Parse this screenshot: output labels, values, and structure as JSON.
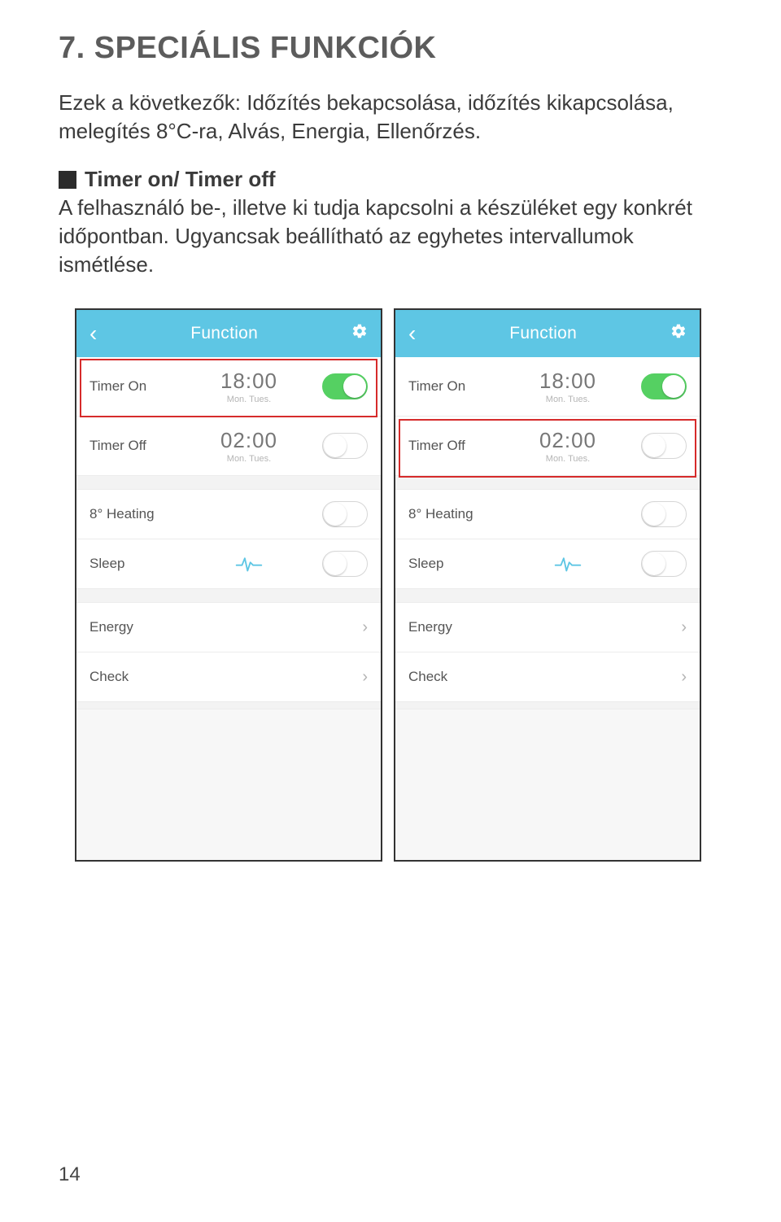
{
  "page": {
    "title": "7. SPECIÁLIS FUNKCIÓK",
    "paragraph": "Ezek a következők: Időzítés bekapcsolása, időzítés kikapcsolása, melegítés 8°C-ra, Alvás, Energia, Ellenőrzés.",
    "sub_heading": "Timer on/ Timer off",
    "sub_body": "A felhasználó be-, illetve ki tudja kapcsolni a készüléket egy konkrét időpontban. Ugyancsak beállítható az egyhetes intervallumok ismétlése.",
    "page_number": "14"
  },
  "app": {
    "header_title": "Function",
    "rows": {
      "timer_on": {
        "label": "Timer On",
        "time": "18:00",
        "days": "Mon. Tues."
      },
      "timer_off": {
        "label": "Timer Off",
        "time": "02:00",
        "days": "Mon. Tues."
      },
      "heating": {
        "label": "8° Heating"
      },
      "sleep": {
        "label": "Sleep"
      },
      "energy": {
        "label": "Energy"
      },
      "check": {
        "label": "Check"
      }
    }
  },
  "phones": {
    "left": {
      "timer_on_toggle": "on",
      "timer_off_toggle": "off",
      "highlight": "timer_on"
    },
    "right": {
      "timer_on_toggle": "on",
      "timer_off_toggle": "off",
      "highlight": "timer_off"
    }
  },
  "colors": {
    "header_bg": "#5ec6e4",
    "toggle_on": "#55d062",
    "highlight_border": "#d62b2b"
  }
}
